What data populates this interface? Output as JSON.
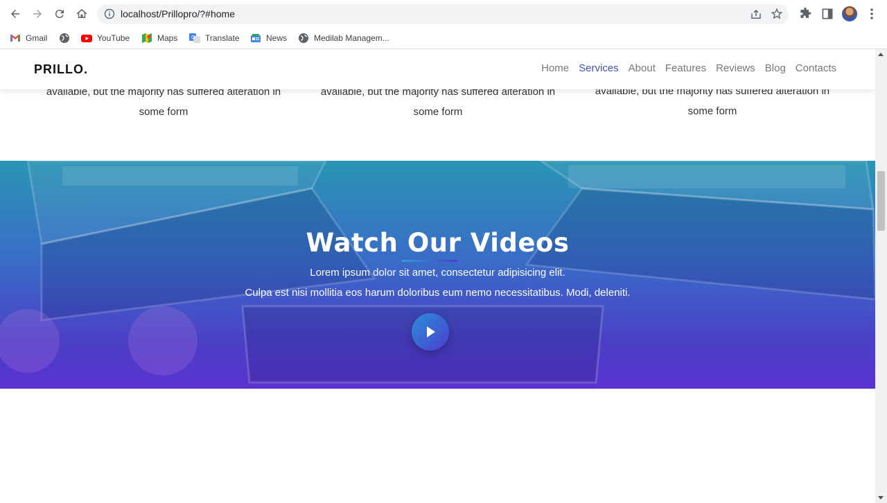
{
  "browser": {
    "url": "localhost/Prillopro/?#home",
    "bookmarks": [
      {
        "label": "Gmail",
        "icon": "gmail-icon"
      },
      {
        "label": "",
        "icon": "globe-icon"
      },
      {
        "label": "YouTube",
        "icon": "youtube-icon"
      },
      {
        "label": "Maps",
        "icon": "maps-icon"
      },
      {
        "label": "Translate",
        "icon": "translate-icon"
      },
      {
        "label": "News",
        "icon": "news-icon"
      },
      {
        "label": "Medilab Managem...",
        "icon": "globe-icon"
      }
    ]
  },
  "header": {
    "logo": "PRILLO.",
    "nav": [
      {
        "label": "Home",
        "active": false
      },
      {
        "label": "Services",
        "active": true
      },
      {
        "label": "About",
        "active": false
      },
      {
        "label": "Features",
        "active": false
      },
      {
        "label": "Reviews",
        "active": false
      },
      {
        "label": "Blog",
        "active": false
      },
      {
        "label": "Contacts",
        "active": false
      }
    ]
  },
  "services": {
    "line1": "available, but the majority has suffered alteration in",
    "line2": "some form"
  },
  "video": {
    "title": "Watch Our Videos",
    "subtitle1": "Lorem ipsum dolor sit amet, consectetur adipisicing elit.",
    "subtitle2": "Culpa est nisi mollitia eos harum doloribus eum nemo necessitatibus. Modi, deleniti.",
    "play_icon": "play-icon"
  },
  "colors": {
    "accent": "#3f51b5",
    "gradient_top": "#2a95b4",
    "gradient_bottom": "#5a33d0"
  }
}
